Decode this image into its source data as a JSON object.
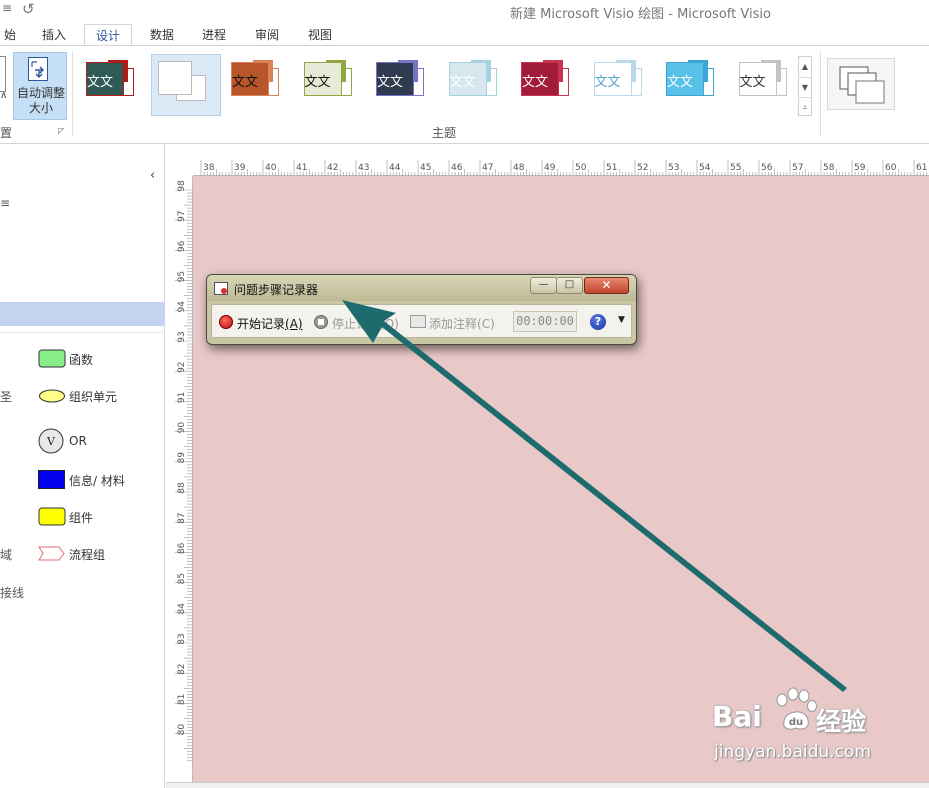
{
  "window": {
    "qat_menu": "≡",
    "qat_undo": "↺",
    "title": "新建 Microsoft Visio 绘图 - Microsoft Visio"
  },
  "tabs": [
    {
      "label": "开始",
      "visible_label": "始"
    },
    {
      "label": "插入"
    },
    {
      "label": "设计",
      "active": true
    },
    {
      "label": "数据"
    },
    {
      "label": "进程"
    },
    {
      "label": "审阅"
    },
    {
      "label": "视图"
    }
  ],
  "ribbon": {
    "page_setup": {
      "autofit_label": "自动调整大小",
      "autofit_label_line1": "自动调整",
      "autofit_label_line2": "大小",
      "group_label_fragment": "置",
      "launcher_icon": "dialog-launcher-icon"
    },
    "themes": {
      "group_label": "主题",
      "sample_text": "文文",
      "items": [
        {
          "front": "#2f5a56",
          "accent": "#b01c1c",
          "text_color": "#ffffff"
        },
        {
          "front": "#ffffff",
          "accent": "#ffffff",
          "text_color": "#333333",
          "selected": true,
          "blank": true
        },
        {
          "front": "#b8562a",
          "accent": "#d9825a",
          "text_color": "#111111"
        },
        {
          "front": "#e8ead8",
          "accent": "#8fa844",
          "text_color": "#111111"
        },
        {
          "front": "#2f3b4f",
          "accent": "#7a72c4",
          "text_color": "#ffffff"
        },
        {
          "front": "#d6e8ee",
          "accent": "#a6d2e0",
          "text_color": "#ffffff"
        },
        {
          "front": "#a01c3a",
          "accent": "#c8344c",
          "text_color": "#ffffff"
        },
        {
          "front": "#ffffff",
          "accent": "#b9d8ea",
          "text_color": "#5aa0cc"
        },
        {
          "front": "#59c1e8",
          "accent": "#3aa6d8",
          "text_color": "#ffffff"
        },
        {
          "front": "#ffffff",
          "accent": "#c3c3c3",
          "text_color": "#333333"
        }
      ],
      "scroll_up": "▲",
      "scroll_down": "▼",
      "scroll_more": "⩡"
    }
  },
  "shape_panel": {
    "collapse_icon": "‹",
    "fragments": [
      "≡",
      "圣",
      "域",
      "接线"
    ],
    "shapes": [
      {
        "label": "函数",
        "icon": "rounded-rect-green"
      },
      {
        "label": "组织单元",
        "icon": "ellipse-yellow"
      },
      {
        "label": "OR",
        "icon": "circle-v",
        "icon_text": "V"
      },
      {
        "label": "信息/ 材料",
        "icon": "rect-blue"
      },
      {
        "label": "组件",
        "icon": "rounded-rect-yellow"
      },
      {
        "label": "流程组",
        "icon": "chevron-outline"
      }
    ]
  },
  "rulers": {
    "top_labels": [
      "38",
      "39",
      "40",
      "41",
      "42",
      "43",
      "44",
      "45",
      "46",
      "47",
      "48",
      "49",
      "50",
      "51",
      "52",
      "53",
      "54",
      "55",
      "56",
      "57",
      "58",
      "59",
      "60",
      "61"
    ],
    "left_labels": [
      "98",
      "97",
      "96",
      "95",
      "94",
      "93",
      "92",
      "91",
      "90",
      "89",
      "88",
      "87",
      "86",
      "85",
      "84",
      "83",
      "82",
      "81",
      "80"
    ]
  },
  "steps_recorder": {
    "title": "问题步骤记录器",
    "minimize": "—",
    "maximize": "□",
    "close": "✕",
    "start_label": "开始记录",
    "start_key": "(A)",
    "stop_label": "停止记录",
    "stop_key": "(O)",
    "comment_label": "添加注释",
    "comment_key": "(C)",
    "elapsed": "00:00:00",
    "help": "?",
    "menu": "▼"
  },
  "watermark": {
    "bai": "Bai",
    "du_icon": "paw-icon",
    "jingyan": "经验",
    "url": "jingyan.baidu.com"
  },
  "colors": {
    "canvas": "#e9c8c8",
    "arrow": "#1e6b6e",
    "accent": "#2b579a"
  }
}
